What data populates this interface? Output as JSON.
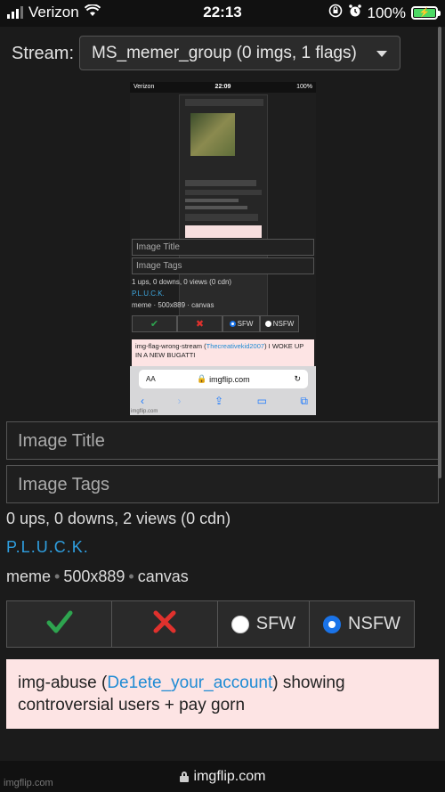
{
  "status_bar": {
    "carrier": "Verizon",
    "time": "22:13",
    "battery": "100%"
  },
  "stream": {
    "label": "Stream:",
    "selected": "MS_memer_group (0 imgs, 1 flags)"
  },
  "embedded_screenshot": {
    "status": {
      "carrier": "Verizon",
      "time": "22:09",
      "battery": "100%"
    },
    "image_title_placeholder": "Image Title",
    "image_tags_placeholder": "Image Tags",
    "stats": "1 ups, 0 downs, 0 views (0 cdn)",
    "user": "P.L.U.C.K.",
    "meta": [
      "meme",
      "500x889",
      "canvas"
    ],
    "sfw_label": "SFW",
    "nsfw_label": "NSFW",
    "flag_prefix": "img-flag-wrong-stream (",
    "flag_user": "Thecreativekid2007",
    "flag_suffix": ") I WOKE UP IN A NEW BUGATTI",
    "address_aa": "AA",
    "address_url": "imgflip.com",
    "watermark": "imgflip.com"
  },
  "form": {
    "image_title_placeholder": "Image Title",
    "image_tags_placeholder": "Image Tags",
    "stats": "0 ups, 0 downs, 2 views (0 cdn)",
    "user": "P.L.U.C.K.",
    "meta": [
      "meme",
      "500x889",
      "canvas"
    ],
    "approve_icon": "✔",
    "reject_icon": "✖",
    "sfw_label": "SFW",
    "nsfw_label": "NSFW",
    "nsfw_selected": true
  },
  "flag": {
    "prefix": "img-abuse (",
    "user": "De1ete_your_account",
    "suffix": ") showing controversial users + pay gorn"
  },
  "bottom": {
    "url": "imgflip.com",
    "watermark": "imgflip.com"
  },
  "colors": {
    "link": "#2f9fe0",
    "approve": "#2ea44f",
    "reject": "#e0312d",
    "flag_bg": "#fde4e4"
  }
}
